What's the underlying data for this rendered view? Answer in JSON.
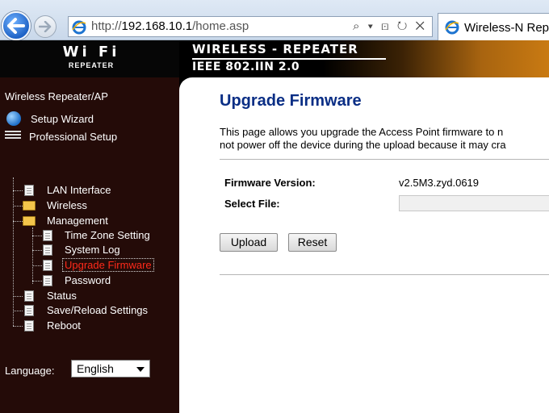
{
  "browser": {
    "url_prefix": "http://",
    "url_host": "192.168.10.1",
    "url_path": "/home.asp",
    "address_tools": "⌕ ▾ ⊡ ↻ ✕",
    "tab_title": "Wireless-N Rep"
  },
  "header": {
    "logo_text": "Wi Fi",
    "logo_sub": "REPEATER",
    "title": "WIRELESS - REPEATER",
    "subtitle": "IEEE 802.IIN 2.0"
  },
  "sidebar": {
    "heading": "Wireless Repeater/AP",
    "setup_wizard": "Setup Wizard",
    "professional_setup": "Professional Setup",
    "lan_interface": "LAN Interface",
    "wireless": "Wireless",
    "management": "Management",
    "time_zone": "Time Zone Setting",
    "system_log": "System Log",
    "upgrade_firmware": "Upgrade Firmware",
    "password": "Password",
    "status": "Status",
    "save_reload": "Save/Reload Settings",
    "reboot": "Reboot",
    "language_label": "Language:",
    "language_value": "English"
  },
  "main": {
    "title": "Upgrade Firmware",
    "description_line1": "This page allows you upgrade the Access Point firmware to n",
    "description_line2": "not power off the device during the upload because it may cra",
    "firmware_version_label": "Firmware Version:",
    "firmware_version_value": "v2.5M3.zyd.0619",
    "select_file_label": "Select File:",
    "upload_button": "Upload",
    "reset_button": "Reset"
  },
  "colors": {
    "title_blue": "#0a2e85",
    "selected_red": "#ff2a1a",
    "sidebar_bg": "#240b08"
  }
}
